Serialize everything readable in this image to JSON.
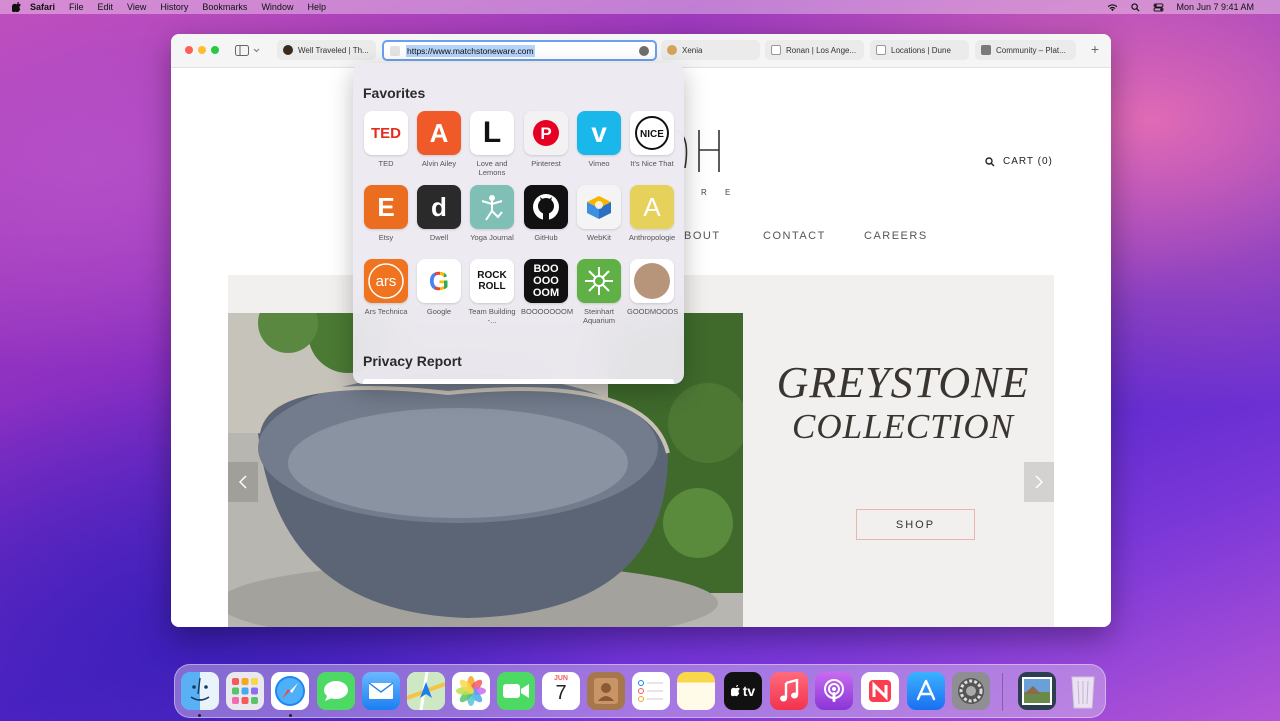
{
  "menubar": {
    "app_name": "Safari",
    "items": [
      "File",
      "Edit",
      "View",
      "History",
      "Bookmarks",
      "Window",
      "Help"
    ],
    "clock": "Mon Jun 7  9:41 AM"
  },
  "browser": {
    "tabs": [
      {
        "label": "Well Traveled | Th..."
      },
      {
        "label": "Xenia"
      },
      {
        "label": "Ronan | Los Ange..."
      },
      {
        "label": "Locations | Dune"
      },
      {
        "label": "Community – Plat..."
      }
    ],
    "url": "https://www.matchstoneware.com",
    "new_tab": "+"
  },
  "page": {
    "logo_sub": "R E",
    "cart": "CART (0)",
    "nav": [
      "BOUT",
      "CONTACT",
      "CAREERS"
    ],
    "hero_title1": "GREYSTONE",
    "hero_title2": "COLLECTION",
    "shop_label": "SHOP"
  },
  "popover": {
    "favorites_heading": "Favorites",
    "privacy_heading": "Privacy Report",
    "favorites": [
      {
        "label": "TED",
        "tile": "TED",
        "bg": "#ffffff",
        "fg": "#e62b1e"
      },
      {
        "label": "Alvin Ailey",
        "tile": "A",
        "bg": "#f05a28",
        "fg": "#ffffff"
      },
      {
        "label": "Love and Lemons",
        "tile": "L",
        "bg": "#ffffff",
        "fg": "#111111"
      },
      {
        "label": "Pinterest",
        "tile": "P",
        "bg": "#f2f2f2",
        "fg": "#e60023"
      },
      {
        "label": "Vimeo",
        "tile": "v",
        "bg": "#1ab7ea",
        "fg": "#ffffff"
      },
      {
        "label": "It's Nice That",
        "tile": "NICE",
        "bg": "#ffffff",
        "fg": "#111111"
      },
      {
        "label": "Etsy",
        "tile": "E",
        "bg": "#eb6d20",
        "fg": "#ffffff"
      },
      {
        "label": "Dwell",
        "tile": "d",
        "bg": "#2a2a2a",
        "fg": "#ffffff"
      },
      {
        "label": "Yoga Journal",
        "tile": "yoga",
        "bg": "#7fbfb6",
        "fg": "#ffffff"
      },
      {
        "label": "GitHub",
        "tile": "github",
        "bg": "#111111",
        "fg": "#ffffff"
      },
      {
        "label": "WebKit",
        "tile": "webkit",
        "bg": "#f4f4f4",
        "fg": "#3d8fe0"
      },
      {
        "label": "Anthropologie",
        "tile": "A",
        "bg": "#e6d15a",
        "fg": "#ffffff"
      },
      {
        "label": "Ars Technica",
        "tile": "ars",
        "bg": "#f0741f",
        "fg": "#ffffff"
      },
      {
        "label": "Google",
        "tile": "G",
        "bg": "#ffffff",
        "fg": "#4285f4"
      },
      {
        "label": "Team Building -...",
        "tile": "ROCK ROLL",
        "bg": "#ffffff",
        "fg": "#111111"
      },
      {
        "label": "BOOOOOOOM",
        "tile": "BOO OOO OOM",
        "bg": "#111111",
        "fg": "#ffffff"
      },
      {
        "label": "Steinhart Aquarium",
        "tile": "steinhart",
        "bg": "#5fb045",
        "fg": "#ffffff"
      },
      {
        "label": "GOODMOODS",
        "tile": "goodmoods",
        "bg": "#ffffff",
        "fg": "#b7957a"
      }
    ]
  },
  "dock": {
    "icons": [
      "Finder",
      "Launchpad",
      "Safari",
      "Messages",
      "Mail",
      "Maps",
      "Photos",
      "FaceTime",
      "Calendar",
      "Contacts",
      "Reminders",
      "Notes",
      "TV",
      "Music",
      "Podcasts",
      "News",
      "App Store",
      "System Preferences",
      "Preview",
      "Trash"
    ],
    "calendar_month": "JUN",
    "calendar_day": "7",
    "tv_label": "tv"
  }
}
